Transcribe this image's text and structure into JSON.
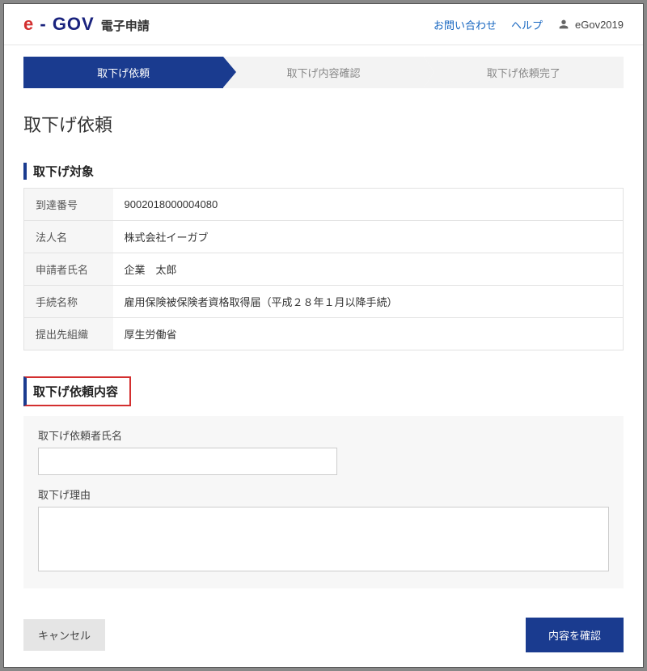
{
  "header": {
    "logo_prefix": "e",
    "logo_dash": " - ",
    "logo_main": "GOV",
    "logo_sub": "電子申請",
    "contact_link": "お問い合わせ",
    "help_link": "ヘルプ",
    "username": "eGov2019"
  },
  "stepper": {
    "step1": "取下げ依頼",
    "step2": "取下げ内容確認",
    "step3": "取下げ依頼完了"
  },
  "page_title": "取下げ依頼",
  "target": {
    "heading": "取下げ対象",
    "rows": {
      "r0_label": "到達番号",
      "r0_value": "9002018000004080",
      "r1_label": "法人名",
      "r1_value": "株式会社イーガブ",
      "r2_label": "申請者氏名",
      "r2_value": "企業　太郎",
      "r3_label": "手続名称",
      "r3_value": "雇用保険被保険者資格取得届（平成２８年１月以降手続）",
      "r4_label": "提出先組織",
      "r4_value": "厚生労働省"
    }
  },
  "request": {
    "heading": "取下げ依頼内容",
    "name_label": "取下げ依頼者氏名",
    "name_value": "",
    "reason_label": "取下げ理由",
    "reason_value": ""
  },
  "footer": {
    "cancel": "キャンセル",
    "confirm": "内容を確認"
  }
}
